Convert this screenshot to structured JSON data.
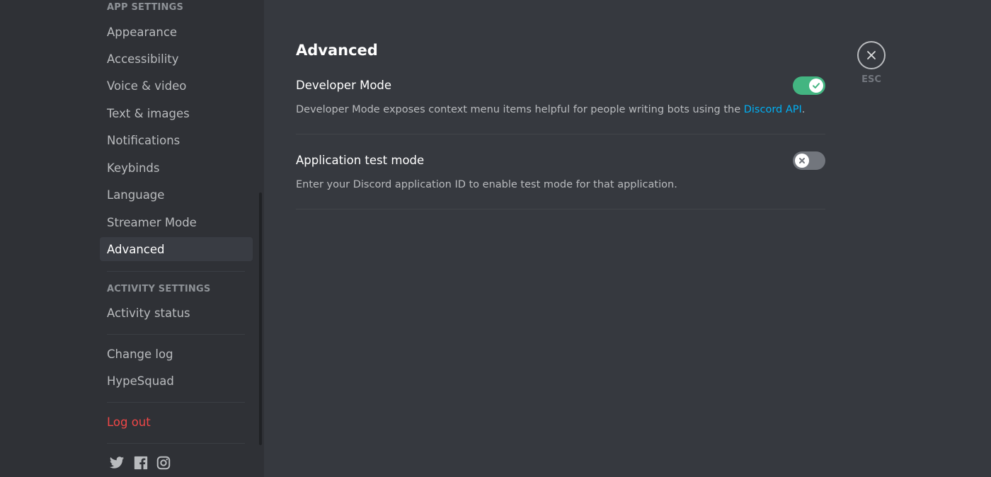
{
  "sidebar": {
    "app_settings_header": "APP SETTINGS",
    "app_items": [
      {
        "label": "Appearance"
      },
      {
        "label": "Accessibility"
      },
      {
        "label": "Voice & video"
      },
      {
        "label": "Text & images"
      },
      {
        "label": "Notifications"
      },
      {
        "label": "Keybinds"
      },
      {
        "label": "Language"
      },
      {
        "label": "Streamer Mode"
      },
      {
        "label": "Advanced",
        "selected": true
      }
    ],
    "activity_settings_header": "ACTIVITY SETTINGS",
    "activity_items": [
      {
        "label": "Activity status"
      }
    ],
    "misc_items": [
      {
        "label": "Change log"
      },
      {
        "label": "HypeSquad"
      }
    ],
    "logout_label": "Log out",
    "social_icons": [
      "twitter-icon",
      "facebook-icon",
      "instagram-icon"
    ]
  },
  "main": {
    "title": "Advanced",
    "settings": [
      {
        "title": "Developer Mode",
        "description_prefix": "Developer Mode exposes context menu items helpful for people writing bots using the ",
        "description_link": "Discord API",
        "description_suffix": ".",
        "enabled": true
      },
      {
        "title": "Application test mode",
        "description": "Enter your Discord application ID to enable test mode for that application.",
        "enabled": false
      }
    ],
    "close_label": "ESC"
  },
  "colors": {
    "sidebar_bg": "#2f3136",
    "content_bg": "#36393f",
    "toggle_on": "#43b581",
    "toggle_off": "#72767d",
    "link": "#00b0f4",
    "danger": "#f04747"
  }
}
